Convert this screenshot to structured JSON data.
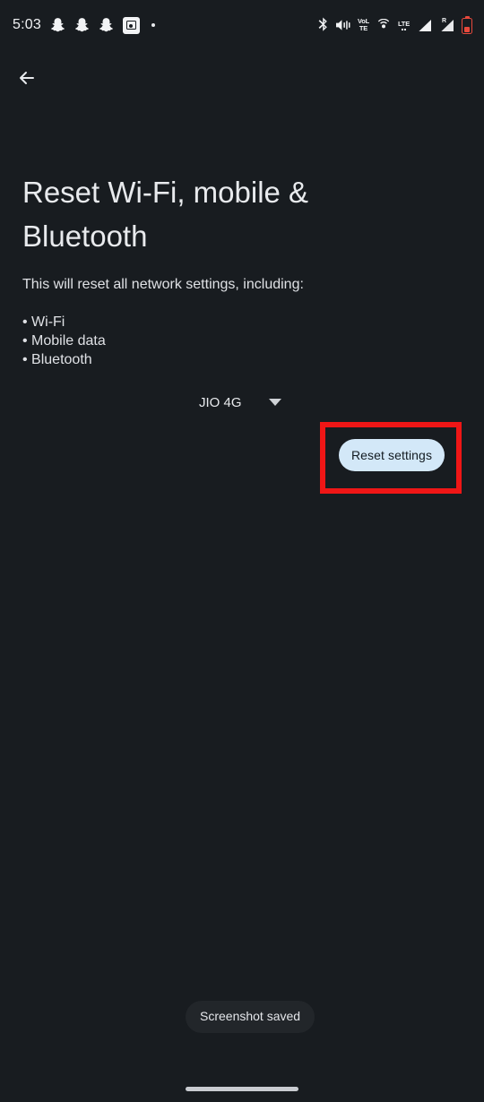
{
  "status_bar": {
    "clock": "5:03",
    "notification_icons": [
      {
        "name": "snapchat-icon",
        "label": "Snapchat"
      },
      {
        "name": "snapchat-icon",
        "label": "Snapchat"
      },
      {
        "name": "snapchat-icon",
        "label": "Snapchat"
      },
      {
        "name": "screenshot-icon",
        "label": "Screenshot"
      }
    ],
    "overflow_indicator": "•",
    "system_icons": [
      {
        "name": "bluetooth-icon",
        "label": "Bluetooth"
      },
      {
        "name": "vibrate-icon",
        "label": "Vibrate"
      },
      {
        "name": "volte-icon",
        "label": "VoLTE"
      },
      {
        "name": "hotspot-icon",
        "label": "Hotspot"
      },
      {
        "name": "lte-signal-icon",
        "label": "LTE"
      },
      {
        "name": "roaming-signal-icon",
        "label": "R"
      },
      {
        "name": "battery-icon",
        "label": "Battery low"
      }
    ],
    "volte_top": "VoL",
    "volte_bottom": "TE",
    "lte_label": "LTE",
    "roaming_label": "R"
  },
  "navigation": {
    "back_label": "Back"
  },
  "main": {
    "title": "Reset Wi-Fi, mobile & Bluetooth",
    "description": "This will reset all network settings, including:",
    "bullets": [
      "• Wi-Fi",
      "• Mobile data",
      "• Bluetooth"
    ]
  },
  "sim_selector": {
    "selected": "JIO 4G",
    "caret": "chevron-down-icon"
  },
  "actions": {
    "reset_settings_label": "Reset settings"
  },
  "toast": {
    "message": "Screenshot saved"
  },
  "colors": {
    "background": "#181c20",
    "text_primary": "#e8eaed",
    "text_secondary": "#dfe1e5",
    "button_fill": "#d3e8f8",
    "button_text": "#131b21",
    "highlight_border": "#ef1616",
    "battery_low": "#e8493c",
    "toast_background": "#22262a",
    "nav_pill": "#c9ccd1"
  }
}
